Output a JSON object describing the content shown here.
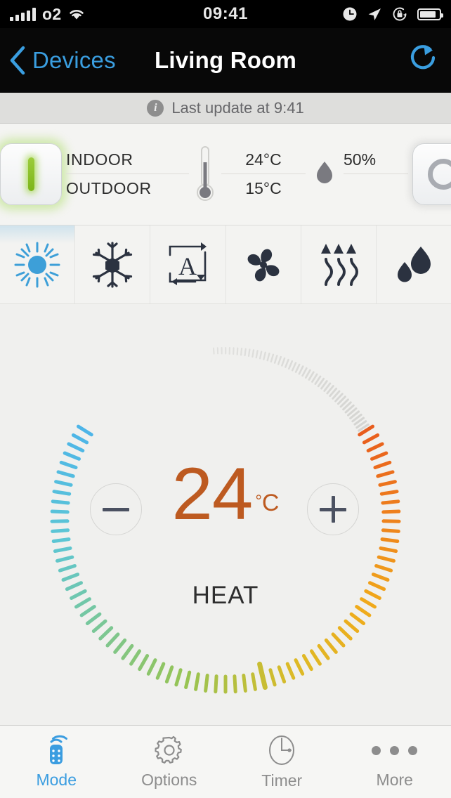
{
  "status_bar": {
    "carrier": "o2",
    "time": "09:41",
    "icons": [
      "signal-bars-icon",
      "wifi-icon",
      "alarm-clock-icon",
      "location-arrow-icon",
      "rotation-lock-icon",
      "battery-icon"
    ]
  },
  "nav": {
    "back_label": "Devices",
    "title": "Living Room",
    "refresh_icon": "refresh-icon",
    "accent": "#3a9ee0"
  },
  "banner": {
    "info_icon": "info-icon",
    "text": "Last update at 9:41"
  },
  "strip": {
    "power_on": {
      "name": "power-on-button",
      "glyph": "I",
      "color": "#8bc53f"
    },
    "power_off": {
      "name": "power-off-button",
      "glyph": "O",
      "color": "#a9acb2"
    },
    "indoor_label": "INDOOR",
    "outdoor_label": "OUTDOOR",
    "thermometer_icon": "thermometer-icon",
    "indoor_temp": "24°C",
    "outdoor_temp": "15°C",
    "droplet_icon": "humidity-droplet-icon",
    "humidity": "50%"
  },
  "modes": [
    {
      "name": "mode-heat-sun",
      "icon": "sun-icon",
      "active": true,
      "color": "#3d9fd8"
    },
    {
      "name": "mode-cool",
      "icon": "snowflake-icon",
      "active": false,
      "color": "#2b3240"
    },
    {
      "name": "mode-auto",
      "icon": "auto-loop-icon",
      "active": false,
      "color": "#2b3240"
    },
    {
      "name": "mode-fan",
      "icon": "fan-icon",
      "active": false,
      "color": "#2b3240"
    },
    {
      "name": "mode-heat",
      "icon": "heat-waves-icon",
      "active": false,
      "color": "#2b3240"
    },
    {
      "name": "mode-dry",
      "icon": "dry-droplets-icon",
      "active": false,
      "color": "#2b3240"
    }
  ],
  "dial": {
    "value": "24",
    "unit_degree": "°",
    "unit_letter": "C",
    "mode_label": "HEAT",
    "decrease_label": "−",
    "increase_label": "+",
    "value_color": "#bd5a20",
    "track_start_color": "#4db5e8",
    "track_end_color": "#ef6c1f",
    "inactive_color": "#d5d5d2"
  },
  "tabs": [
    {
      "label": "Mode",
      "icon": "remote-control-icon",
      "active": true
    },
    {
      "label": "Options",
      "icon": "gear-icon",
      "active": false
    },
    {
      "label": "Timer",
      "icon": "clock-icon",
      "active": false
    },
    {
      "label": "More",
      "icon": "ellipsis-icon",
      "active": false
    }
  ]
}
